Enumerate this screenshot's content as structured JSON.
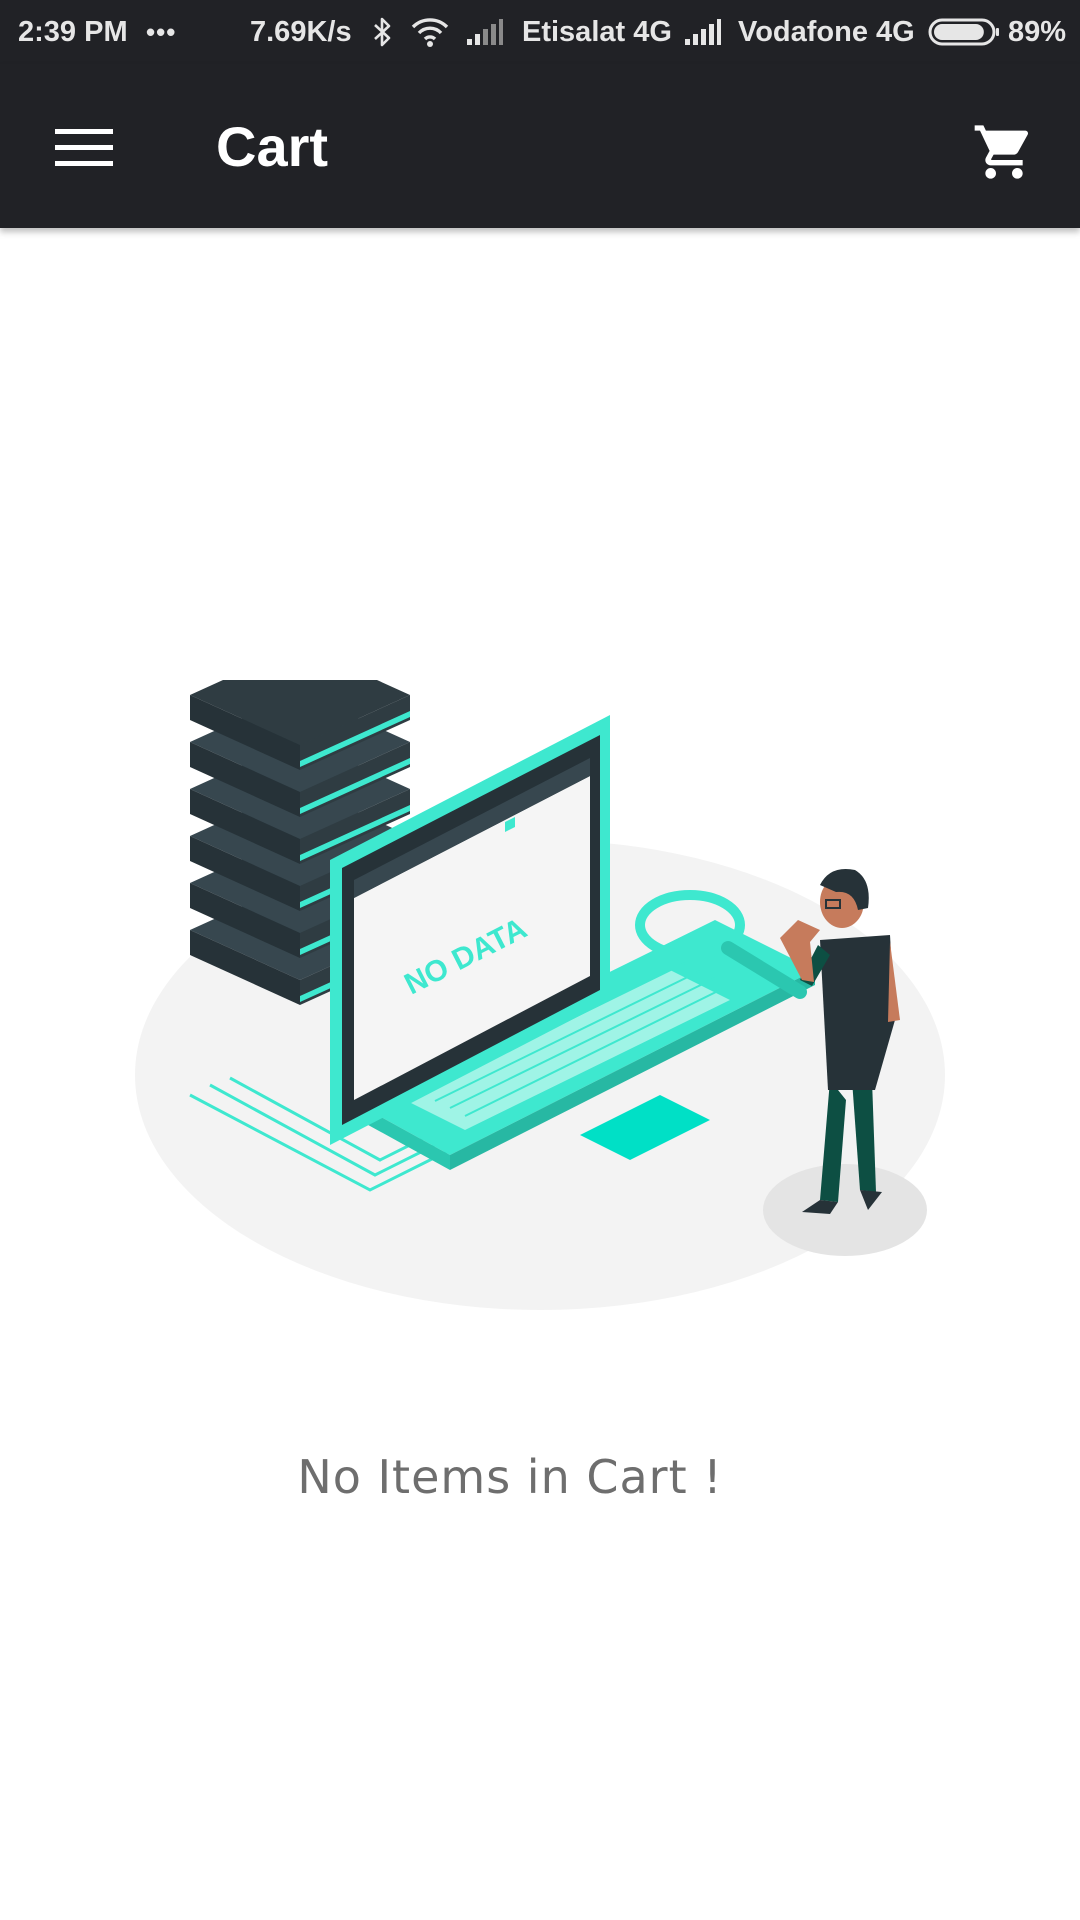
{
  "status_bar": {
    "time": "2:39 PM",
    "more": "•••",
    "speed": "7.69K/s",
    "carrier1": "Etisalat 4G",
    "carrier2": "Vodafone 4G",
    "battery": "89%",
    "battery_level": 0.89,
    "icons": [
      "bluetooth-icon",
      "wifi-icon",
      "signal-icon",
      "battery-icon"
    ]
  },
  "app_bar": {
    "title": "Cart",
    "menu_icon": "hamburger-menu-icon",
    "cart_icon": "shopping-cart-icon",
    "background": "#212226"
  },
  "illustration": {
    "screen_text": "NO DATA",
    "accent": "#3ee8cf",
    "dark": "#263238"
  },
  "empty_state": {
    "message": "No Items in Cart !"
  }
}
